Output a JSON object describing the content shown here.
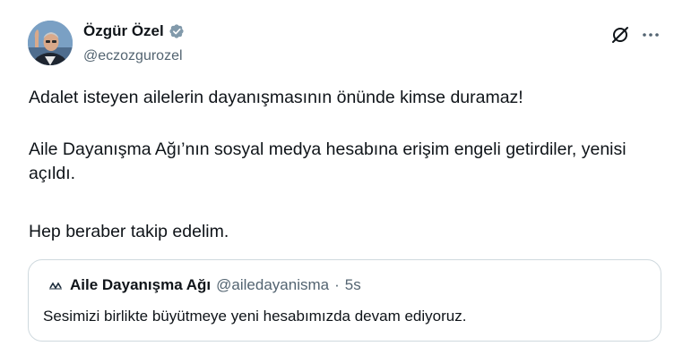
{
  "author": {
    "display_name": "Özgür Özel",
    "handle": "@eczozgurozel",
    "verified_badge_color": "#829aab"
  },
  "actions": {
    "grok_icon": "grok-icon",
    "more_icon": "more-dots-icon"
  },
  "post": {
    "paragraph_1": "Adalet isteyen ailelerin dayanışmasının önünde kimse duramaz!",
    "paragraph_2": "Aile Dayanışma Ağı’nın sosyal medya hesabına erişim engeli getirdiler, yenisi açıldı.",
    "paragraph_3": "Hep beraber takip edelim."
  },
  "quoted_post": {
    "logo_text": "AİDA",
    "display_name": "Aile Dayanışma Ağı",
    "handle": "@ailedayanisma",
    "separator": "·",
    "time": "5s",
    "text": "Sesimizi birlikte büyütmeye yeni hesabımızda devam ediyoruz."
  }
}
